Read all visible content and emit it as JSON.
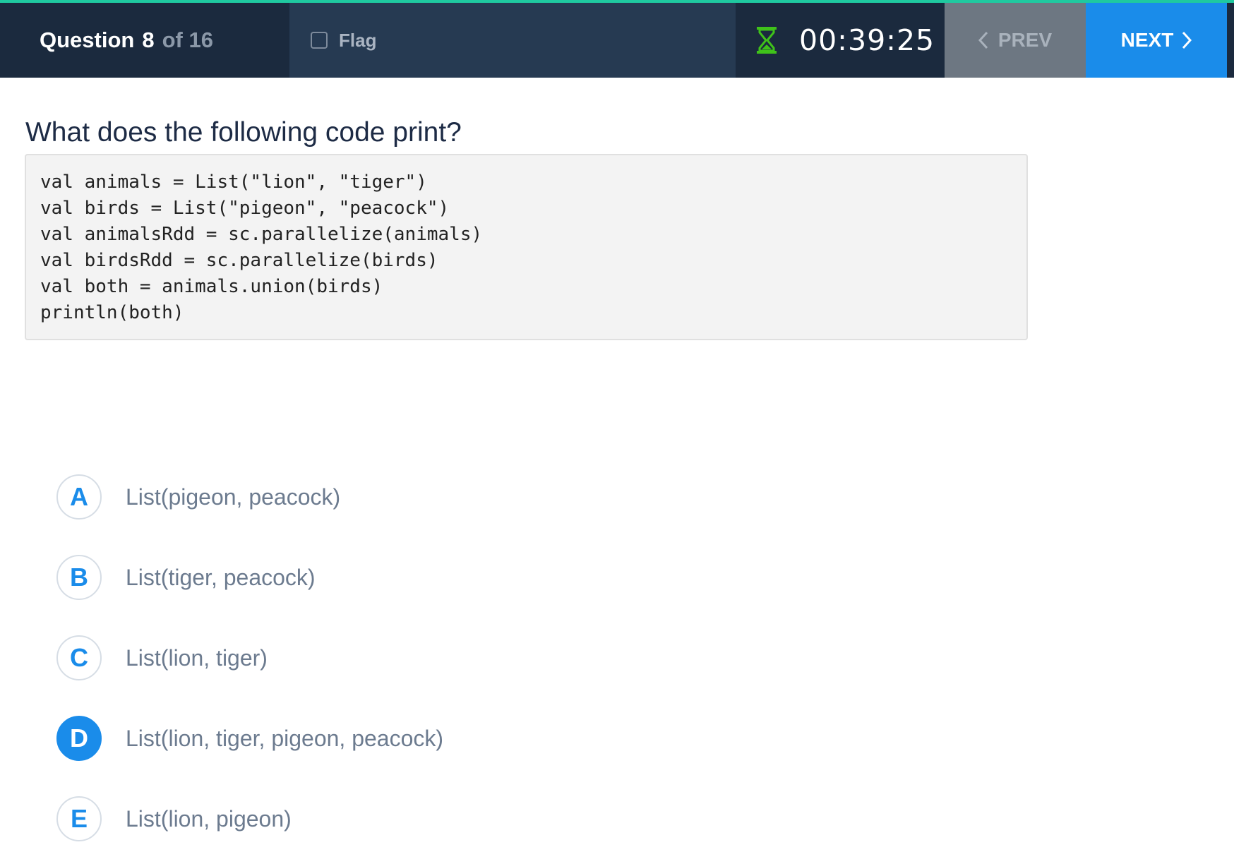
{
  "header": {
    "question_word": "Question",
    "question_number": "8",
    "question_total": "of 16",
    "flag_label": "Flag",
    "flag_checked": false,
    "timer": "00:39:25",
    "prev_label": "PREV",
    "next_label": "NEXT"
  },
  "question": {
    "title": "What does the following code print?",
    "code_lines": [
      "val animals = List(\"lion\", \"tiger\")",
      "val birds = List(\"pigeon\", \"peacock\")",
      "val animalsRdd = sc.parallelize(animals)",
      "val birdsRdd = sc.parallelize(birds)",
      "val both = animals.union(birds)",
      "println(both)"
    ]
  },
  "answers": [
    {
      "letter": "A",
      "text": "List(pigeon, peacock)",
      "selected": false
    },
    {
      "letter": "B",
      "text": "List(tiger, peacock)",
      "selected": false
    },
    {
      "letter": "C",
      "text": "List(lion, tiger)",
      "selected": false
    },
    {
      "letter": "D",
      "text": "List(lion, tiger, pigeon, peacock)",
      "selected": true
    },
    {
      "letter": "E",
      "text": "List(lion, pigeon)",
      "selected": false
    }
  ],
  "colors": {
    "accent": "#1fc9a0",
    "topbar": "#1b2a3e",
    "primary_blue": "#1a8cea",
    "timer_icon": "#3fc21a"
  },
  "icons": {
    "timer": "hourglass-icon",
    "prev": "chevron-left-icon",
    "next": "chevron-right-icon",
    "flag": "checkbox-icon"
  }
}
